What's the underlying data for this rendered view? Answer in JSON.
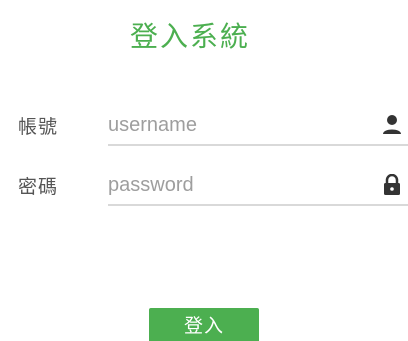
{
  "title": "登入系統",
  "fields": {
    "username": {
      "label": "帳號",
      "placeholder": "username",
      "value": "",
      "icon": "person-icon"
    },
    "password": {
      "label": "密碼",
      "placeholder": "password",
      "value": "",
      "icon": "lock-icon"
    }
  },
  "login_button": {
    "label": "登入"
  },
  "colors": {
    "accent": "#4caf50",
    "label_text": "#555555",
    "placeholder": "#9e9e9e",
    "underline": "#d9d9d9"
  }
}
